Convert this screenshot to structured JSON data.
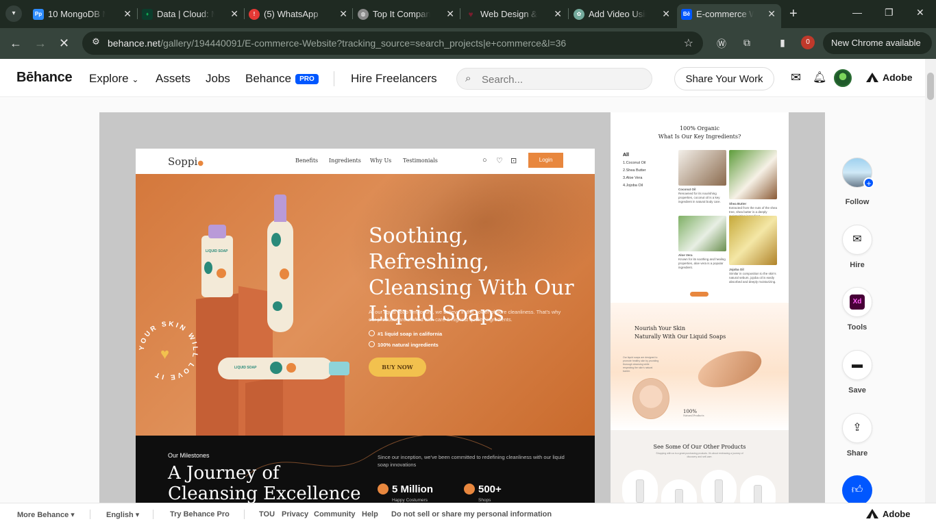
{
  "browser": {
    "tabs": [
      {
        "title": "10 MongoDB Mi",
        "icon": "pp-icon",
        "color": "#2d8cff"
      },
      {
        "title": "Data | Cloud: Mc",
        "icon": "mongodb-leaf-icon",
        "color": "#13aa52"
      },
      {
        "title": "(5) WhatsApp",
        "icon": "whatsapp-alert-icon",
        "color": "#e53935"
      },
      {
        "title": "Top It Company",
        "icon": "globe-icon",
        "color": "#8a8a8a"
      },
      {
        "title": "Web Design & D",
        "icon": "heart-icon",
        "color": "#7a1d2e"
      },
      {
        "title": "Add Video Using",
        "icon": "chatgpt-icon",
        "color": "#74aa9c"
      },
      {
        "title": "E-commerce We",
        "icon": "behance-icon",
        "color": "#0057ff"
      }
    ],
    "url_domain": "behance.net",
    "url_path": "/gallery/194440091/E-commerce-Website?tracking_source=search_projects|e+commerce&l=36",
    "extension_badge": "0",
    "update_label": "New Chrome available"
  },
  "header": {
    "logo": "Bēhance",
    "nav": {
      "explore": "Explore",
      "assets": "Assets",
      "jobs": "Jobs",
      "behance": "Behance",
      "pro": "PRO",
      "hire": "Hire Freelancers"
    },
    "search_placeholder": "Search...",
    "share_label": "Share Your Work",
    "adobe": "Adobe"
  },
  "project": {
    "soppi": {
      "logo": "Soppi",
      "nav": [
        "Benefits",
        "Ingredients",
        "Why Us",
        "Testimonials"
      ],
      "login": "Login",
      "hero_title": "Soothing, Refreshing, Cleansing With Our Liquid Soaps",
      "hero_desc": "At our liquid soap emporium, we believe in the power of pure cleanliness. That's why our products are crafted with care & highest quality ingredients.",
      "check1": "#1 liquid soap in california",
      "check2": "100% natural ingredients",
      "buy": "BUY NOW",
      "stamp": "YOUR SKIN WILL LOVE IT",
      "bottle_label": "LIQUID SOAP",
      "milestones_label": "Our Milestones",
      "milestones_title": "A Journey of Cleansing Excellence",
      "milestones_desc": "Since our inception, we've been committed to redefining cleanliness with our liquid soap innovations",
      "stat1": {
        "value": "5 Million",
        "label": "Happy Costumers"
      },
      "stat2": {
        "value": "500+",
        "label": "Shops"
      }
    },
    "right": {
      "organic_title": "100% Organic\nWhat Is Our Key Ingredients?",
      "list_all": "All",
      "list": [
        "1.Coconut Oil",
        "2.Shea Butter",
        "3.Aloe Vera",
        "4.Jojoba Oil"
      ],
      "ingredients": [
        {
          "name": "Coconut Oil",
          "desc": "Renowned for its nourishing properties, coconut oil is a key ingredient in natural body care."
        },
        {
          "name": "Shea Butter",
          "desc": "Extracted from the nuts of the shea tree, shea butter is a deeply moisturizing ingredient."
        },
        {
          "name": "Aloe Vera",
          "desc": "Known for its soothing and healing properties, aloe vera is a popular ingredient."
        },
        {
          "name": "Jojoba Oil",
          "desc": "Similar in composition to the skin's natural sebum, jojoba oil is easily absorbed and deeply moisturizing."
        }
      ],
      "nourish_title": "Nourish Your Skin\nNaturally With Our Liquid Soaps",
      "nourish_desc": "Our liquid soaps are designed to promote healthy skin by providing thorough cleansing while respecting the skin's natural barrier.",
      "nourish_pct": "100%",
      "nourish_pct_label": "Natural Products",
      "other_title": "See Some Of Our Other Products",
      "other_sub": "Shopping with us is a great purchasing products. It's about embracing a journey of discovery and self-care."
    }
  },
  "side_actions": {
    "follow": "Follow",
    "hire": "Hire",
    "tools": "Tools",
    "xd": "Xd",
    "save": "Save",
    "share": "Share"
  },
  "footer": {
    "more": "More Behance ▾",
    "language": "English ▾",
    "try_pro": "Try Behance Pro",
    "links": [
      "TOU",
      "Privacy",
      "Community",
      "Help",
      "Do not sell or share my personal information"
    ],
    "adobe": "Adobe"
  }
}
